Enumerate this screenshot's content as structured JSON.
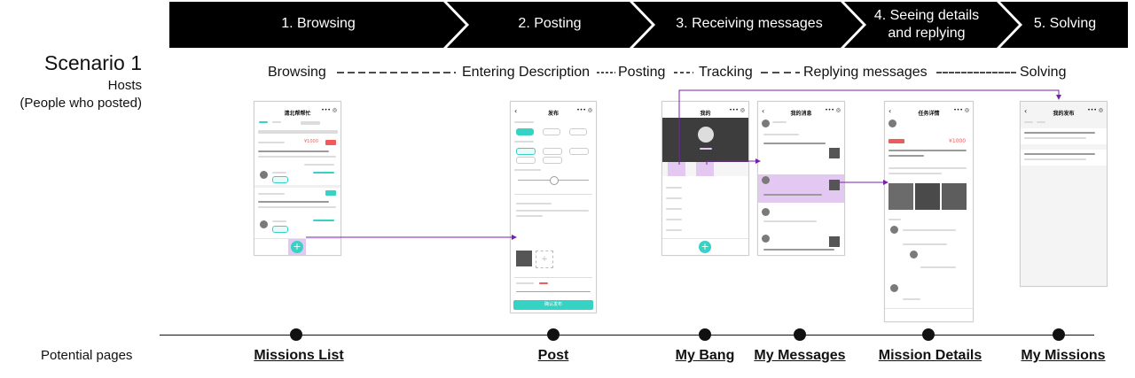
{
  "stages": [
    {
      "label": "1. Browsing"
    },
    {
      "label": "2. Posting"
    },
    {
      "label": "3. Receiving messages"
    },
    {
      "label": "4. Seeing details and replying"
    },
    {
      "label": "5. Solving"
    }
  ],
  "scenario": {
    "title": "Scenario 1",
    "sub1": "Hosts",
    "sub2": "(People who posted)"
  },
  "flow": {
    "browsing": "Browsing",
    "entering": "Entering Description",
    "posting": "Posting",
    "tracking": "Tracking",
    "replying": "Replying messages",
    "solving": "Solving"
  },
  "screens": {
    "list_title": "清北帮帮忙",
    "post_title": "发布",
    "bang_title": "我的",
    "messages_title": "我的消息",
    "details_title": "任务详情",
    "missions_title": "我的发布",
    "list_price": "¥1000",
    "details_price": "¥1000",
    "post_confirm": "确认发布"
  },
  "potential_pages_label": "Potential pages",
  "pages": [
    {
      "label": "Missions List"
    },
    {
      "label": "Post"
    },
    {
      "label": "My Bang"
    },
    {
      "label": "My Messages"
    },
    {
      "label": "Mission Details"
    },
    {
      "label": "My Missions"
    }
  ],
  "colors": {
    "banner": "#000000",
    "accent": "#36d3c5",
    "arrow": "#7a1fb0",
    "highlight": "#e3c9f2"
  }
}
